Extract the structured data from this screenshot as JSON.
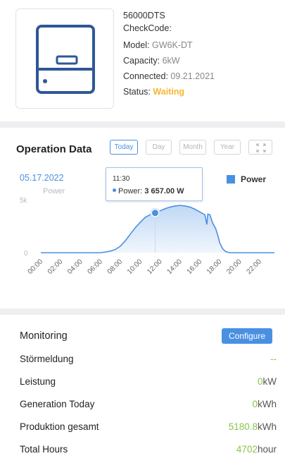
{
  "device": {
    "serial": "56000DTS",
    "checkcode_label": "CheckCode:",
    "model_label": "Model:",
    "model_value": "GW6K-DT",
    "capacity_label": "Capacity:",
    "capacity_value": "6kW",
    "connected_label": "Connected:",
    "connected_value": "09.21.2021",
    "status_label": "Status:",
    "status_value": "Waiting",
    "status_color": "#f5b731",
    "image_icon": "inverter-icon"
  },
  "operation": {
    "title": "Operation Data",
    "ranges": [
      "Today",
      "Day",
      "Month",
      "Year"
    ],
    "active_range": "Today",
    "fullscreen_icon": "fullscreen-icon",
    "date": "05.17.2022",
    "legend": "Power",
    "tooltip": {
      "time": "11:30",
      "label": "Power:",
      "value": "3 657.00 W"
    }
  },
  "chart_data": {
    "type": "area",
    "series": [
      {
        "name": "Power",
        "color": "#4a90e2"
      }
    ],
    "ylabel": "Power",
    "ytick_labels": [
      "5k",
      "0"
    ],
    "ylim": [
      0,
      5000
    ],
    "xlim": [
      0,
      23.5
    ],
    "xtick_labels": [
      "00:00",
      "02:00",
      "04:00",
      "06:00",
      "08:00",
      "10:00",
      "12:00",
      "14:00",
      "16:00",
      "18:00",
      "20:00",
      "22:00"
    ],
    "x": [
      0,
      6,
      6.5,
      7,
      7.5,
      8,
      8.5,
      9,
      9.5,
      10,
      10.5,
      11,
      11.5,
      12,
      12.5,
      13,
      13.5,
      14,
      14.5,
      15,
      15.5,
      16,
      16.5,
      16.7,
      16.8,
      17,
      17.3,
      17.6,
      17.8,
      18,
      18.3,
      18.6,
      19,
      23.5
    ],
    "y": [
      0,
      0,
      60,
      150,
      300,
      600,
      1100,
      1700,
      2300,
      2800,
      3250,
      3500,
      3657,
      3850,
      4050,
      4200,
      4300,
      4350,
      4300,
      4200,
      4000,
      3750,
      3500,
      2600,
      3550,
      3500,
      2700,
      2200,
      1600,
      900,
      350,
      100,
      0,
      0
    ],
    "highlight": {
      "x": 11.5,
      "y": 3657
    }
  },
  "monitoring": {
    "title": "Monitoring",
    "configure_label": "Configure",
    "rows": [
      {
        "label": "Störmeldung",
        "value": "--",
        "unit": ""
      },
      {
        "label": "Leistung",
        "value": "0",
        "unit": "kW"
      },
      {
        "label": "Generation Today",
        "value": "0",
        "unit": "kWh"
      },
      {
        "label": "Produktion gesamt",
        "value": "5180.8",
        "unit": "kWh"
      },
      {
        "label": "Total Hours",
        "value": "4702",
        "unit": "hour"
      }
    ]
  }
}
